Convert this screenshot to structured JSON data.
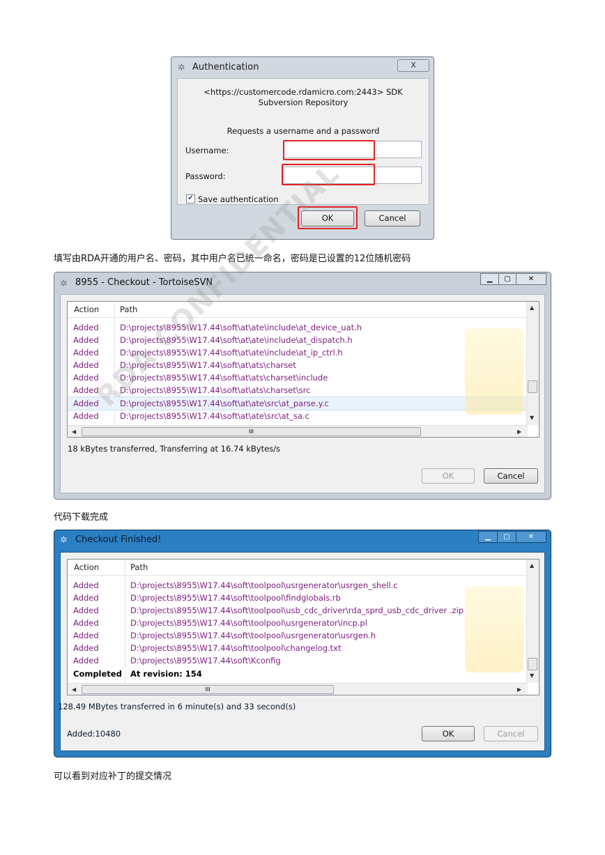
{
  "auth_dialog": {
    "title": "Authentication",
    "close_glyph": "X",
    "repo_text": "<https://customercode.rdamicro.com:2443> SDK Subversion Repository",
    "request_text": "Requests a username and a password",
    "username_label": "Username:",
    "password_label": "Password:",
    "username_value": "",
    "password_value": "",
    "save_auth_label": "Save authentication",
    "save_auth_checked": true,
    "ok_label": "OK",
    "cancel_label": "Cancel"
  },
  "caption1": "填写由RDA开通的用户名、密码，其中用户名已统一命名，密码是已设置的12位随机密码",
  "checkout_window": {
    "title": "8955 - Checkout - TortoiseSVN",
    "col_action": "Action",
    "col_path": "Path",
    "rows": [
      {
        "action": "Added",
        "path": "D:\\projects\\8955\\W17.44\\soft\\at\\ate\\include\\at_device_uat.h"
      },
      {
        "action": "Added",
        "path": "D:\\projects\\8955\\W17.44\\soft\\at\\ate\\include\\at_dispatch.h"
      },
      {
        "action": "Added",
        "path": "D:\\projects\\8955\\W17.44\\soft\\at\\ate\\include\\at_ip_ctrl.h"
      },
      {
        "action": "Added",
        "path": "D:\\projects\\8955\\W17.44\\soft\\at\\ats\\charset"
      },
      {
        "action": "Added",
        "path": "D:\\projects\\8955\\W17.44\\soft\\at\\ats\\charset\\include"
      },
      {
        "action": "Added",
        "path": "D:\\projects\\8955\\W17.44\\soft\\at\\ats\\charset\\src"
      },
      {
        "action": "Added",
        "path": "D:\\projects\\8955\\W17.44\\soft\\at\\ate\\src\\at_parse.y.c"
      },
      {
        "action": "Added",
        "path": "D:\\projects\\8955\\W17.44\\soft\\at\\ate\\src\\at_sa.c"
      }
    ],
    "status": "18 kBytes transferred, Transferring at 16.74 kBytes/s",
    "ok_label": "OK",
    "cancel_label": "Cancel",
    "scroll_marker": "III"
  },
  "caption2": "代码下载完成",
  "finished_window": {
    "title": "Checkout Finished!",
    "col_action": "Action",
    "col_path": "Path",
    "rows": [
      {
        "action": "Added",
        "path": "D:\\projects\\8955\\W17.44\\soft\\toolpool\\usrgenerator\\usrgen_shell.c"
      },
      {
        "action": "Added",
        "path": "D:\\projects\\8955\\W17.44\\soft\\toolpool\\findglobals.rb"
      },
      {
        "action": "Added",
        "path": "D:\\projects\\8955\\W17.44\\soft\\toolpool\\usb_cdc_driver\\rda_sprd_usb_cdc_driver .zip"
      },
      {
        "action": "Added",
        "path": "D:\\projects\\8955\\W17.44\\soft\\toolpool\\usrgenerator\\incp.pl"
      },
      {
        "action": "Added",
        "path": "D:\\projects\\8955\\W17.44\\soft\\toolpool\\usrgenerator\\usrgen.h"
      },
      {
        "action": "Added",
        "path": "D:\\projects\\8955\\W17.44\\soft\\toolpool\\changelog.txt"
      },
      {
        "action": "Added",
        "path": "D:\\projects\\8955\\W17.44\\soft\\Kconfig"
      }
    ],
    "completed_row": {
      "action": "Completed",
      "path": "At revision: 154"
    },
    "status": "128.49 MBytes transferred in 6 minute(s) and 33 second(s)",
    "added_count": "Added:10480",
    "ok_label": "OK",
    "cancel_label": "Cancel",
    "scroll_marker": "III"
  },
  "caption3": "可以看到对应补丁的提交情况",
  "watermark": "RDA CONFIDENTIAL"
}
